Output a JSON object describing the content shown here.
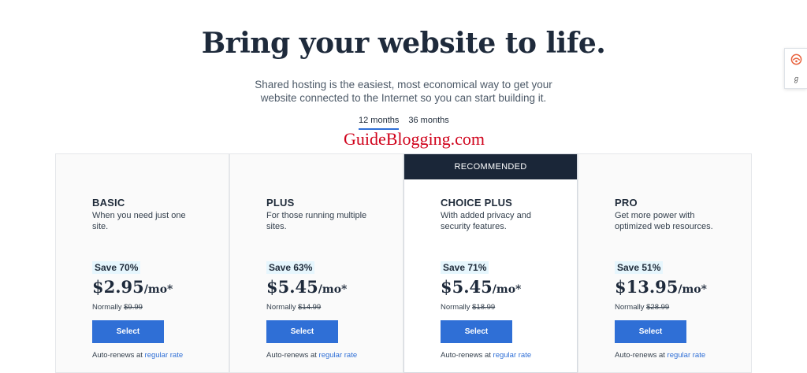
{
  "hero": {
    "title": "Bring your website to life.",
    "subtitle": "Shared hosting is the easiest, most economical way to get your website connected to the Internet so you can start building it."
  },
  "term_tabs": [
    {
      "label": "12 months",
      "active": true
    },
    {
      "label": "36 months",
      "active": false
    }
  ],
  "watermark": "GuideBlogging.com",
  "side_widget": {
    "bottom_glyph": "ℊ"
  },
  "plans": [
    {
      "name": "BASIC",
      "desc": "When you need just one site.",
      "save": "Save 70%",
      "price": "$2.95",
      "unit": "/mo*",
      "normally_label": "Normally",
      "normally_price": "$9.99",
      "select": "Select",
      "auto_renew": "Auto-renews at",
      "rate_link": "regular rate"
    },
    {
      "name": "PLUS",
      "desc": "For those running multiple sites.",
      "save": "Save 63%",
      "price": "$5.45",
      "unit": "/mo*",
      "normally_label": "Normally",
      "normally_price": "$14.99",
      "select": "Select",
      "auto_renew": "Auto-renews at",
      "rate_link": "regular rate"
    },
    {
      "name": "CHOICE PLUS",
      "banner": "RECOMMENDED",
      "desc": "With added privacy and security features.",
      "save": "Save 71%",
      "price": "$5.45",
      "unit": "/mo*",
      "normally_label": "Normally",
      "normally_price": "$18.99",
      "select": "Select",
      "auto_renew": "Auto-renews at",
      "rate_link": "regular rate"
    },
    {
      "name": "PRO",
      "desc": "Get more power with optimized web resources.",
      "save": "Save 51%",
      "price": "$13.95",
      "unit": "/mo*",
      "normally_label": "Normally",
      "normally_price": "$28.99",
      "select": "Select",
      "auto_renew": "Auto-renews at",
      "rate_link": "regular rate"
    }
  ],
  "colors": {
    "accent": "#2f6fd6",
    "banner": "#1a2638",
    "save_bg": "#e6f6fd",
    "watermark": "#d0021b"
  }
}
